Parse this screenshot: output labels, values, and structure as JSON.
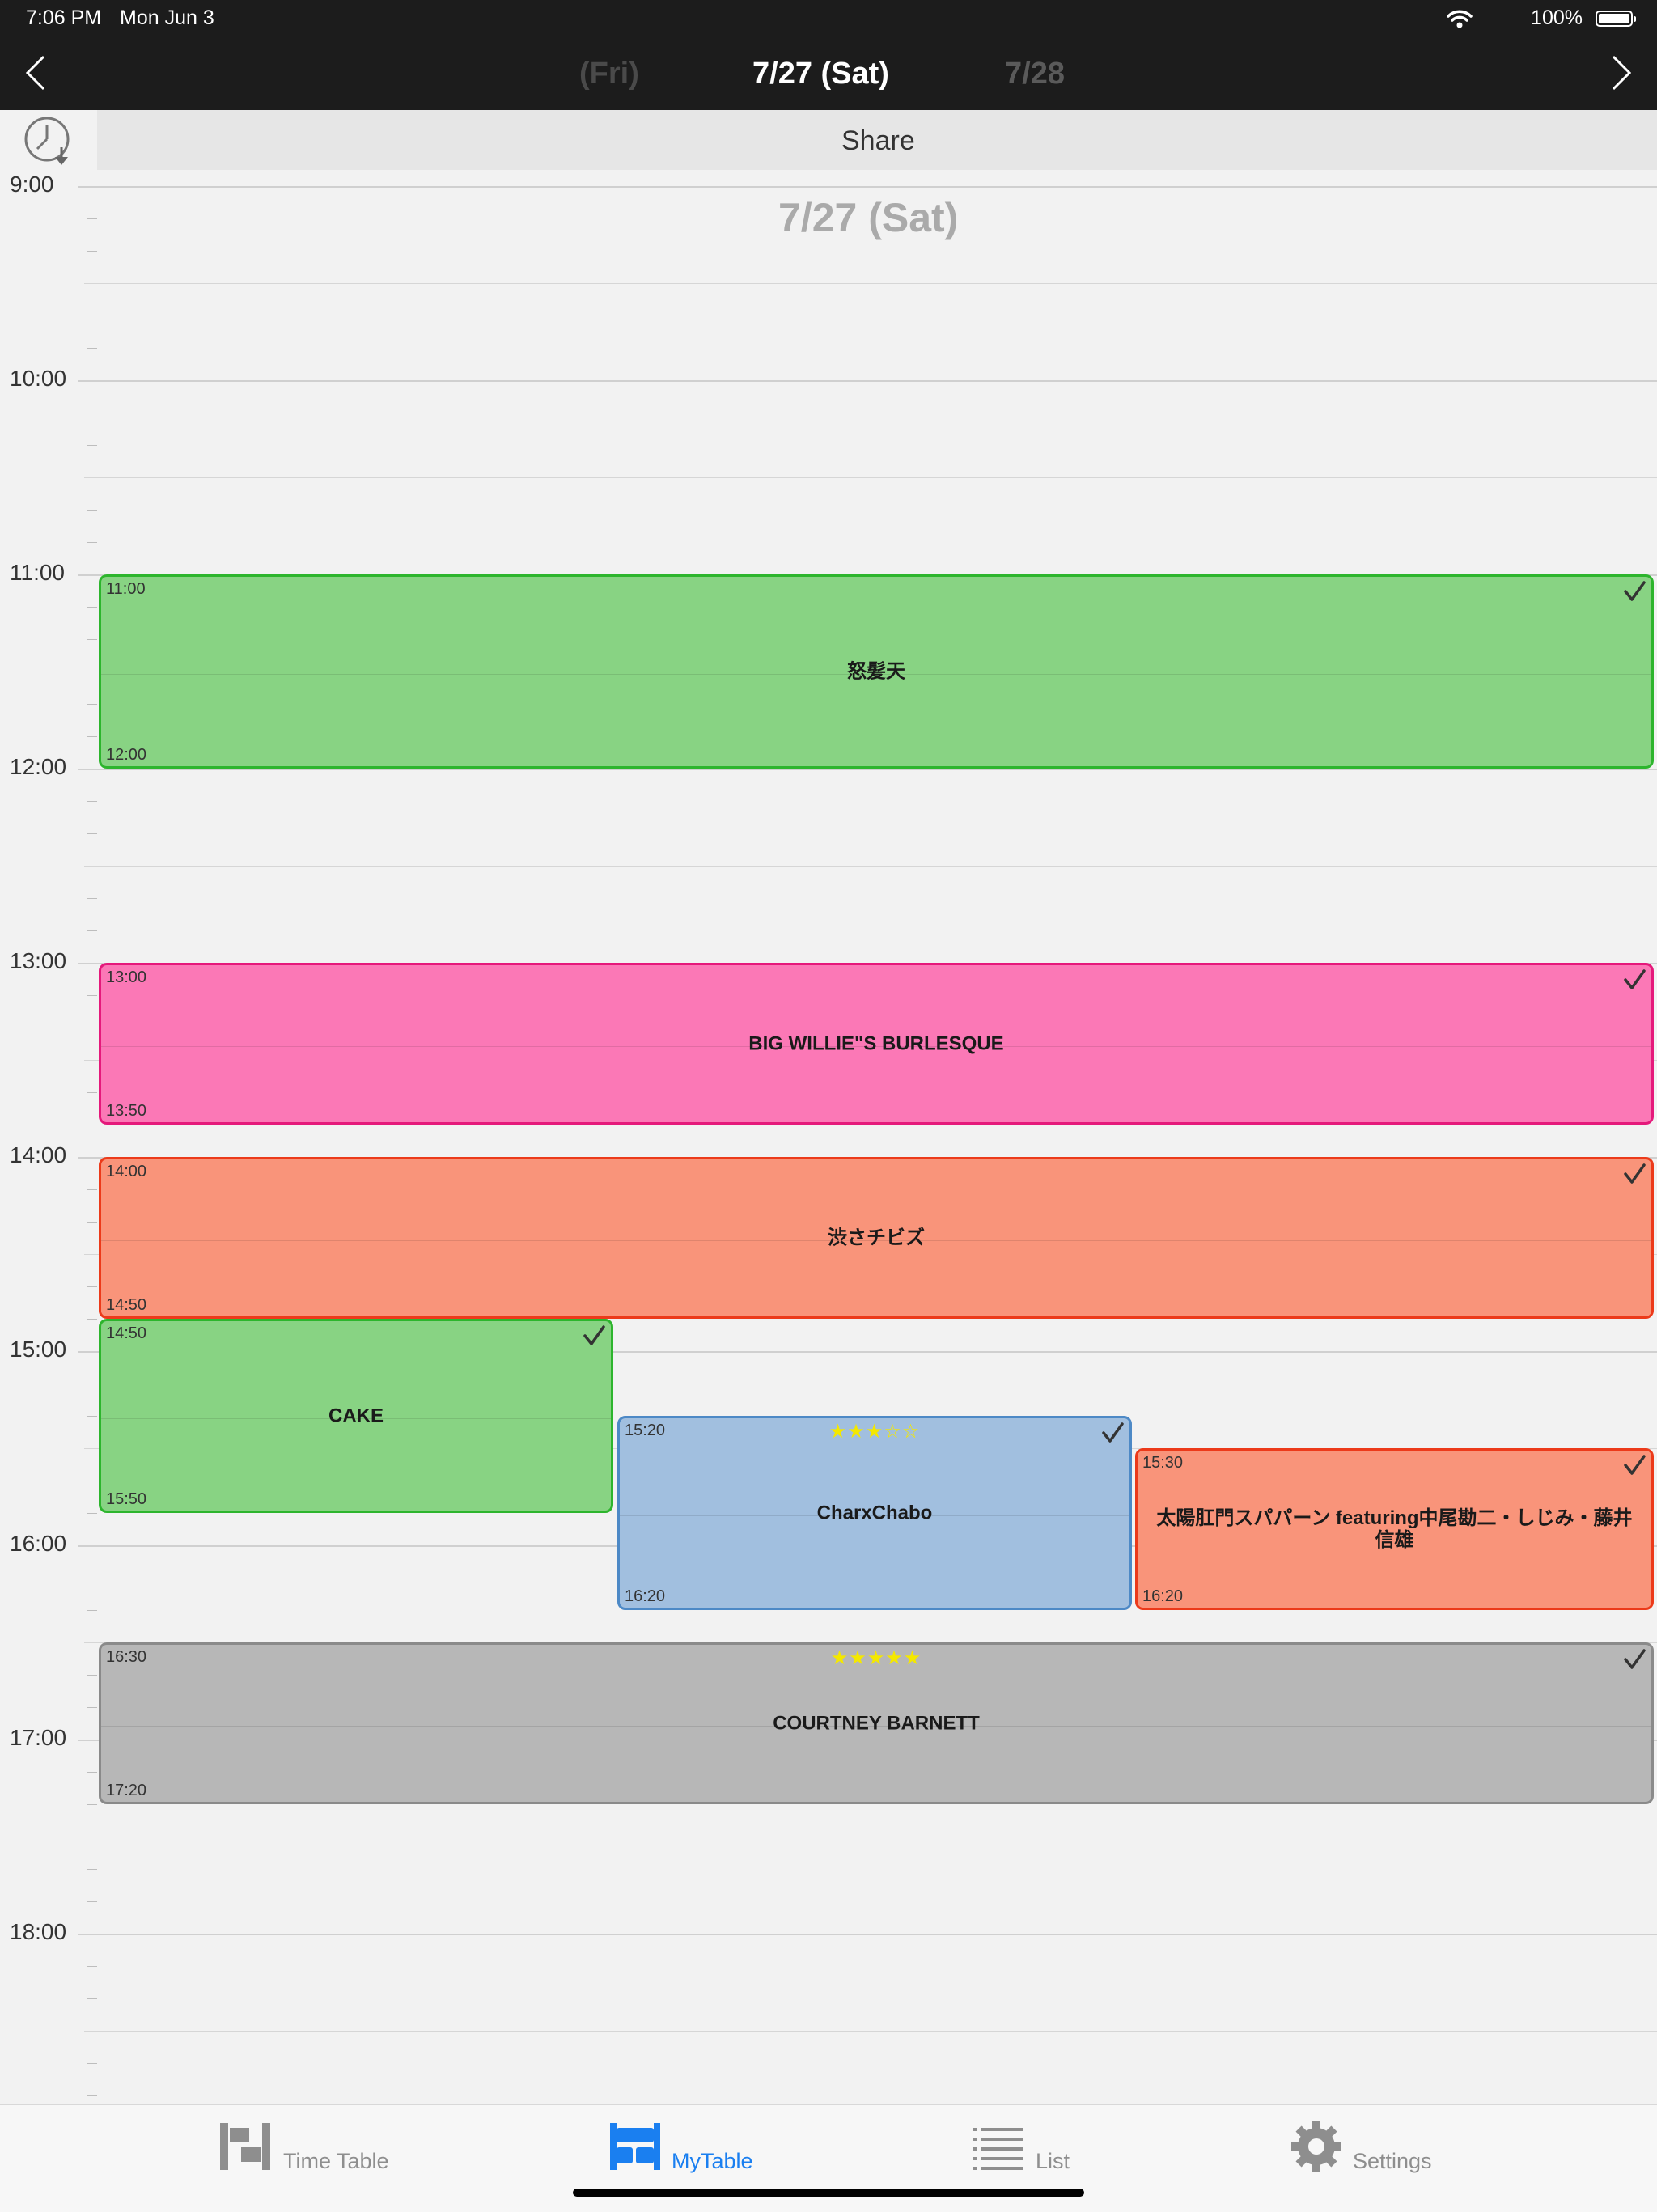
{
  "status_bar": {
    "time": "7:06 PM",
    "date": "Mon Jun 3",
    "battery": "100%"
  },
  "nav": {
    "prev_day": "(Fri)",
    "current_day": "7/27 (Sat)",
    "next_day": "7/28"
  },
  "share_label": "Share",
  "date_watermark": "7/27 (Sat)",
  "hours": [
    "9:00",
    "10:00",
    "11:00",
    "12:00",
    "13:00",
    "14:00",
    "15:00",
    "16:00",
    "17:00",
    "18:00"
  ],
  "events": [
    {
      "start": "11:00",
      "end": "12:00",
      "name": "怒髪天",
      "color": "#88d383",
      "checked": true,
      "stars": ""
    },
    {
      "start": "13:00",
      "end": "13:50",
      "name": "BIG WILLIE\"S BURLESQUE",
      "color": "#fb78b6",
      "checked": true,
      "stars": ""
    },
    {
      "start": "14:00",
      "end": "14:50",
      "name": "渋さチビズ",
      "color": "#f9947a",
      "checked": true,
      "stars": ""
    },
    {
      "start": "14:50",
      "end": "15:50",
      "name": "CAKE",
      "color": "#88d383",
      "checked": true,
      "stars": ""
    },
    {
      "start": "15:20",
      "end": "16:20",
      "name": "CharxChabo",
      "color": "#a1bfdf",
      "checked": true,
      "stars": "★★★☆☆"
    },
    {
      "start": "15:30",
      "end": "16:20",
      "name": "太陽肛門スパパーン featuring中尾勘二・しじみ・藤井信雄",
      "color": "#f9947a",
      "checked": true,
      "stars": ""
    },
    {
      "start": "16:30",
      "end": "17:20",
      "name": "COURTNEY BARNETT",
      "color": "#b7b7b7",
      "checked": true,
      "stars": "★★★★★"
    }
  ],
  "tabs": [
    {
      "label": "Time Table",
      "icon": "timetable-icon",
      "active": false
    },
    {
      "label": "MyTable",
      "icon": "mytable-icon",
      "active": true
    },
    {
      "label": "List",
      "icon": "list-icon",
      "active": false
    },
    {
      "label": "Settings",
      "icon": "gear-icon",
      "active": false
    }
  ],
  "colors": {
    "accent": "#1a7ff0",
    "header_bg": "#1c1c1c",
    "tab_inactive": "#8e8e8e"
  }
}
